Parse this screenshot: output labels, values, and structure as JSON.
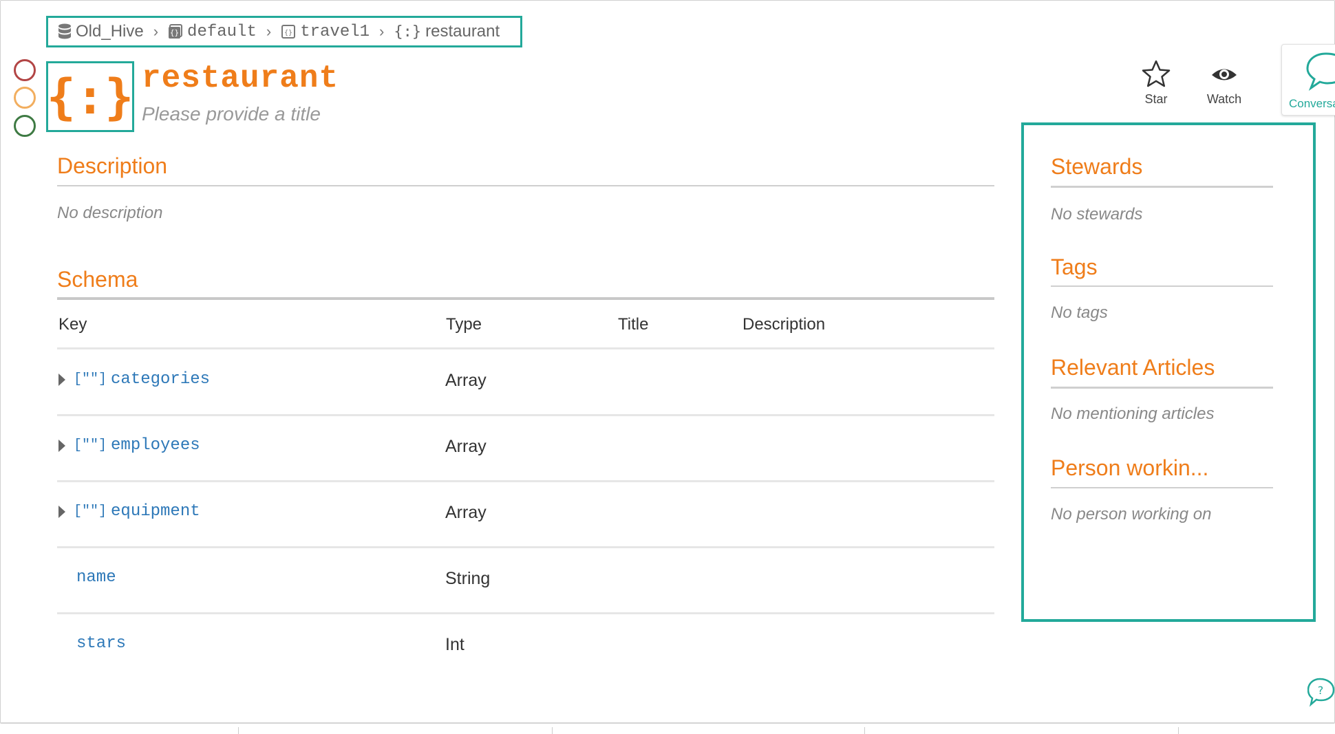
{
  "breadcrumb": {
    "items": [
      {
        "icon": "database-icon",
        "label": "Old_Hive"
      },
      {
        "icon": "schema-icon",
        "label": "default"
      },
      {
        "icon": "table-icon",
        "label": "travel1"
      },
      {
        "icon": "object-icon",
        "label": "restaurant"
      }
    ]
  },
  "header": {
    "type_glyph": "{:}",
    "title": "restaurant",
    "subtitle": "Please provide a title"
  },
  "actions": {
    "star": "Star",
    "watch": "Watch",
    "conversation": "Conversations"
  },
  "main": {
    "description_title": "Description",
    "description_empty": "No description",
    "schema_title": "Schema",
    "columns": [
      "Key",
      "Type",
      "Title",
      "Description"
    ],
    "rows": [
      {
        "key": "categories",
        "type": "Array",
        "expandable": true
      },
      {
        "key": "employees",
        "type": "Array",
        "expandable": true
      },
      {
        "key": "equipment",
        "type": "Array",
        "expandable": true
      },
      {
        "key": "name",
        "type": "String",
        "expandable": false
      },
      {
        "key": "stars",
        "type": "Int",
        "expandable": false
      }
    ],
    "array_glyph": "[\"\"]"
  },
  "sidebar": {
    "stewards_title": "Stewards",
    "stewards_empty": "No stewards",
    "tags_title": "Tags",
    "tags_empty": "No tags",
    "articles_title": "Relevant Articles",
    "articles_empty": "No mentioning articles",
    "person_title": "Person workin...",
    "person_empty": "No person working on"
  },
  "colors": {
    "accent": "#ef7d1a",
    "highlight": "#23a99a",
    "link": "#2d78b8",
    "circle_red": "#b24545",
    "circle_orange": "#f2ae5f",
    "circle_green": "#3e7a43"
  }
}
